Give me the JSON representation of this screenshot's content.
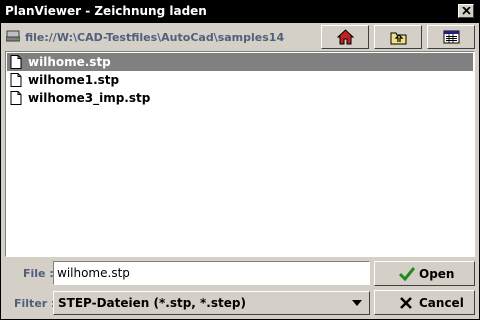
{
  "window": {
    "title": "PlanViewer - Zeichnung laden"
  },
  "pathbar": {
    "path": "file://W:\\CAD-Testfiles\\AutoCad\\samples14",
    "icons": [
      "drive-icon",
      "home-icon",
      "folder-up-icon",
      "list-view-icon"
    ]
  },
  "files": [
    {
      "name": "wilhome.stp",
      "selected": true
    },
    {
      "name": "wilhome1.stp",
      "selected": false
    },
    {
      "name": "wilhome3_imp.stp",
      "selected": false
    }
  ],
  "form": {
    "file_label": "File :",
    "file_value": "wilhome.stp",
    "filter_label": "Filter :",
    "filter_value": "STEP-Dateien (*.stp, *.step)"
  },
  "buttons": {
    "open": "Open",
    "cancel": "Cancel"
  },
  "colors": {
    "titlebar": "#000000",
    "window_bg": "#d4d0c8",
    "selection": "#808080",
    "label_text": "#50607a",
    "open_check": "#1f8a1f"
  }
}
